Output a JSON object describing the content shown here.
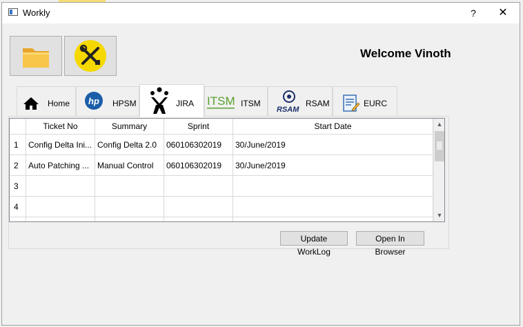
{
  "window": {
    "title": "Workly",
    "help_label": "?",
    "close_label": "✕"
  },
  "toolbar": {
    "buttons": [
      {
        "name": "open-folder",
        "icon": "folder-icon"
      },
      {
        "name": "settings",
        "icon": "tools-icon"
      }
    ]
  },
  "welcome": "Welcome Vinoth",
  "tabs": [
    {
      "label": "Home",
      "icon": "home-icon"
    },
    {
      "label": "HPSM",
      "icon": "hp-icon"
    },
    {
      "label": "JIRA",
      "icon": "jira-icon",
      "active": true
    },
    {
      "label": "ITSM",
      "icon": "itsm-icon"
    },
    {
      "label": "RSAM",
      "icon": "rsam-icon"
    },
    {
      "label": "EURC",
      "icon": "eurc-icon"
    }
  ],
  "table": {
    "columns": [
      "Ticket No",
      "Summary",
      "Sprint",
      "Start Date"
    ],
    "rows": [
      {
        "num": "1",
        "cells": [
          "Config Delta Ini...",
          "Config Delta 2.0",
          "060106302019",
          "30/June/2019"
        ]
      },
      {
        "num": "2",
        "cells": [
          "Auto Patching ...",
          "Manual Control",
          "060106302019",
          "30/June/2019"
        ]
      },
      {
        "num": "3",
        "cells": [
          "",
          "",
          "",
          ""
        ]
      },
      {
        "num": "4",
        "cells": [
          "",
          "",
          "",
          ""
        ]
      }
    ]
  },
  "buttons": {
    "update": "Update WorkLog",
    "open": "Open In Browser"
  },
  "colors": {
    "tools_icon_bg": "#f5d800",
    "hp_blue": "#1a5ea8",
    "itsm_green": "#5aa02c"
  },
  "tab_icon_text": {
    "hp": "hp",
    "itsm": "ITSM",
    "rsam": "RSAM"
  }
}
